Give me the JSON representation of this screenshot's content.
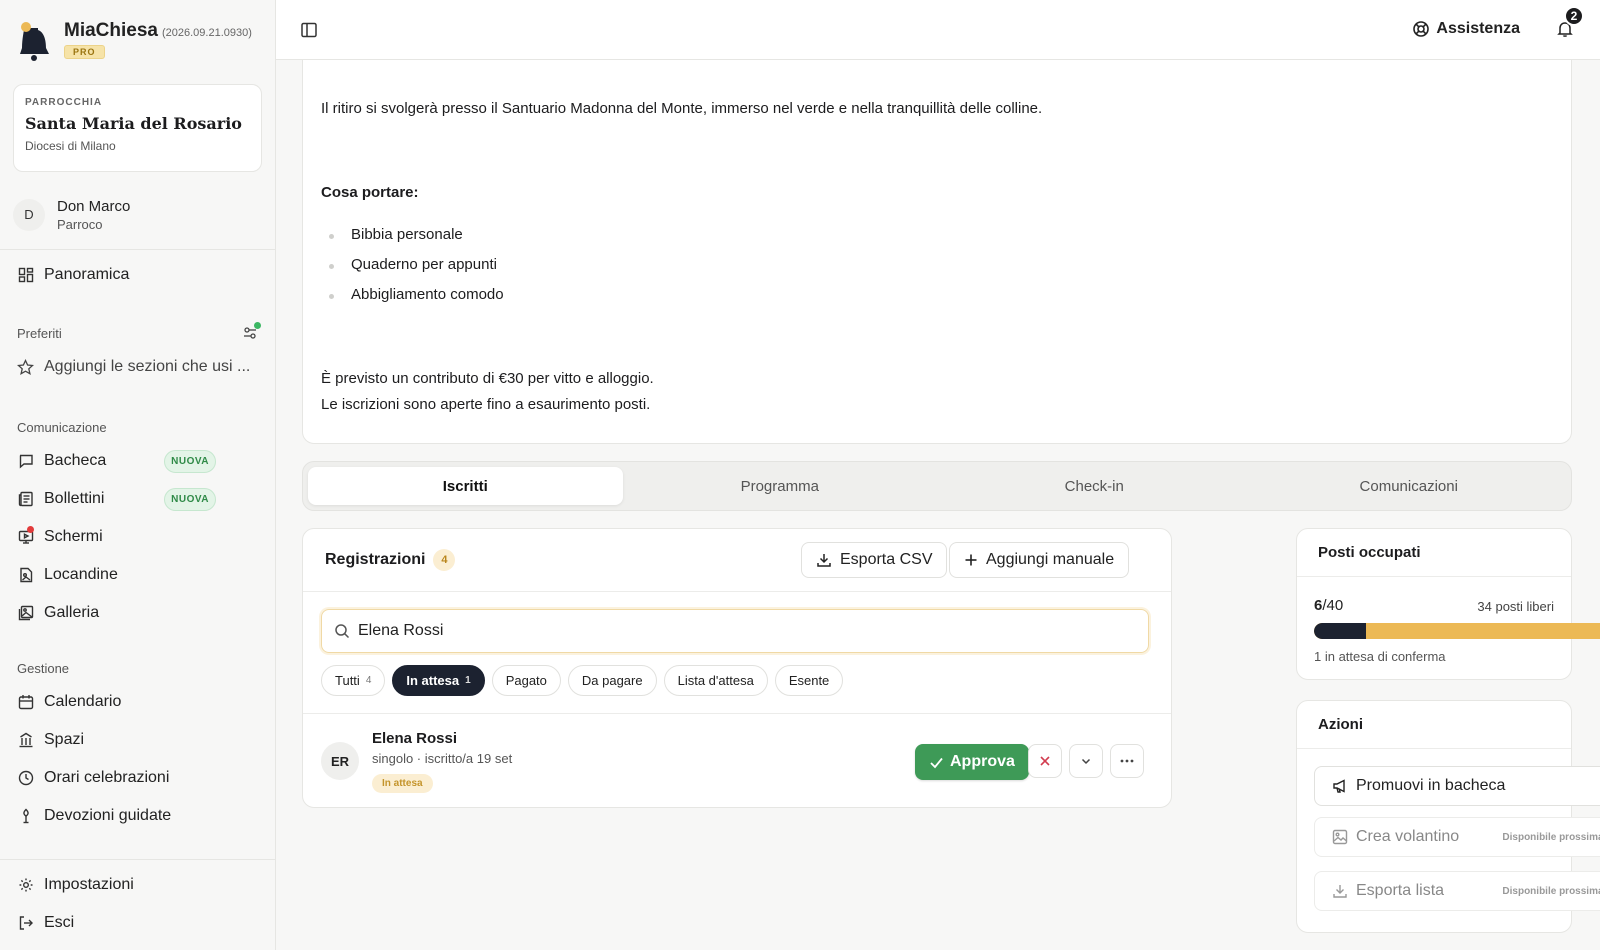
{
  "brand": {
    "name": "MiaChiesa",
    "version": "(2026.09.21.0930)",
    "plan": "PRO"
  },
  "parish": {
    "label": "PARROCCHIA",
    "name": "Santa Maria del Rosario",
    "diocese": "Diocesi di Milano"
  },
  "user": {
    "initial": "D",
    "name": "Don Marco",
    "role": "Parroco"
  },
  "nav": {
    "overview": "Panoramica",
    "favorites_label": "Preferiti",
    "favorites_hint": "Aggiungi le sezioni che usi ...",
    "communication_label": "Comunicazione",
    "communication": [
      {
        "label": "Bacheca",
        "badge": "NUOVA"
      },
      {
        "label": "Bollettini",
        "badge": "NUOVA"
      },
      {
        "label": "Schermi"
      },
      {
        "label": "Locandine"
      },
      {
        "label": "Galleria"
      }
    ],
    "management_label": "Gestione",
    "management": [
      {
        "label": "Calendario"
      },
      {
        "label": "Spazi"
      },
      {
        "label": "Orari celebrazioni"
      },
      {
        "label": "Devozioni guidate"
      }
    ],
    "settings": "Impostazioni",
    "logout": "Esci"
  },
  "topbar": {
    "help": "Assistenza",
    "notifications_count": "2"
  },
  "description": {
    "location": "Il ritiro si svolgerà presso il Santuario Madonna del Monte, immerso nel verde e nella tranquillità delle colline.",
    "bring_title": "Cosa portare:",
    "bring_items": [
      "Bibbia personale",
      "Quaderno per appunti",
      "Abbigliamento comodo"
    ],
    "cost": "È previsto un contributo di €30 per vitto e alloggio.",
    "registrations_note": "Le iscrizioni sono aperte fino a esaurimento posti."
  },
  "tabs": [
    "Iscritti",
    "Programma",
    "Check-in",
    "Comunicazioni"
  ],
  "registrations": {
    "title": "Registrazioni",
    "count": "4",
    "export_csv": "Esporta CSV",
    "add_manual": "Aggiungi manuale",
    "search_value": "Elena Rossi",
    "filters": [
      {
        "label": "Tutti",
        "count": "4"
      },
      {
        "label": "In attesa",
        "count": "1"
      },
      {
        "label": "Pagato"
      },
      {
        "label": "Da pagare"
      },
      {
        "label": "Lista d'attesa"
      },
      {
        "label": "Esente"
      }
    ],
    "row": {
      "initials": "ER",
      "name": "Elena Rossi",
      "meta": "singolo · iscritto/a 19 set",
      "status": "In attesa",
      "approve": "Approva"
    }
  },
  "seats": {
    "title": "Posti occupati",
    "occupied": "6",
    "total": "/40",
    "free": "34 posti liberi",
    "fill_fraction": 0.15,
    "pending": "1 in attesa di conferma"
  },
  "actions": {
    "title": "Azioni",
    "promote": "Promuovi in bacheca",
    "flyer": "Crea volantino",
    "export": "Esporta lista",
    "soon": "Disponibile prossimamente"
  },
  "colors": {
    "accent": "#ecb955",
    "dark": "#1c2230",
    "approve": "#3e9a57",
    "new_badge": "#2f8a47"
  }
}
